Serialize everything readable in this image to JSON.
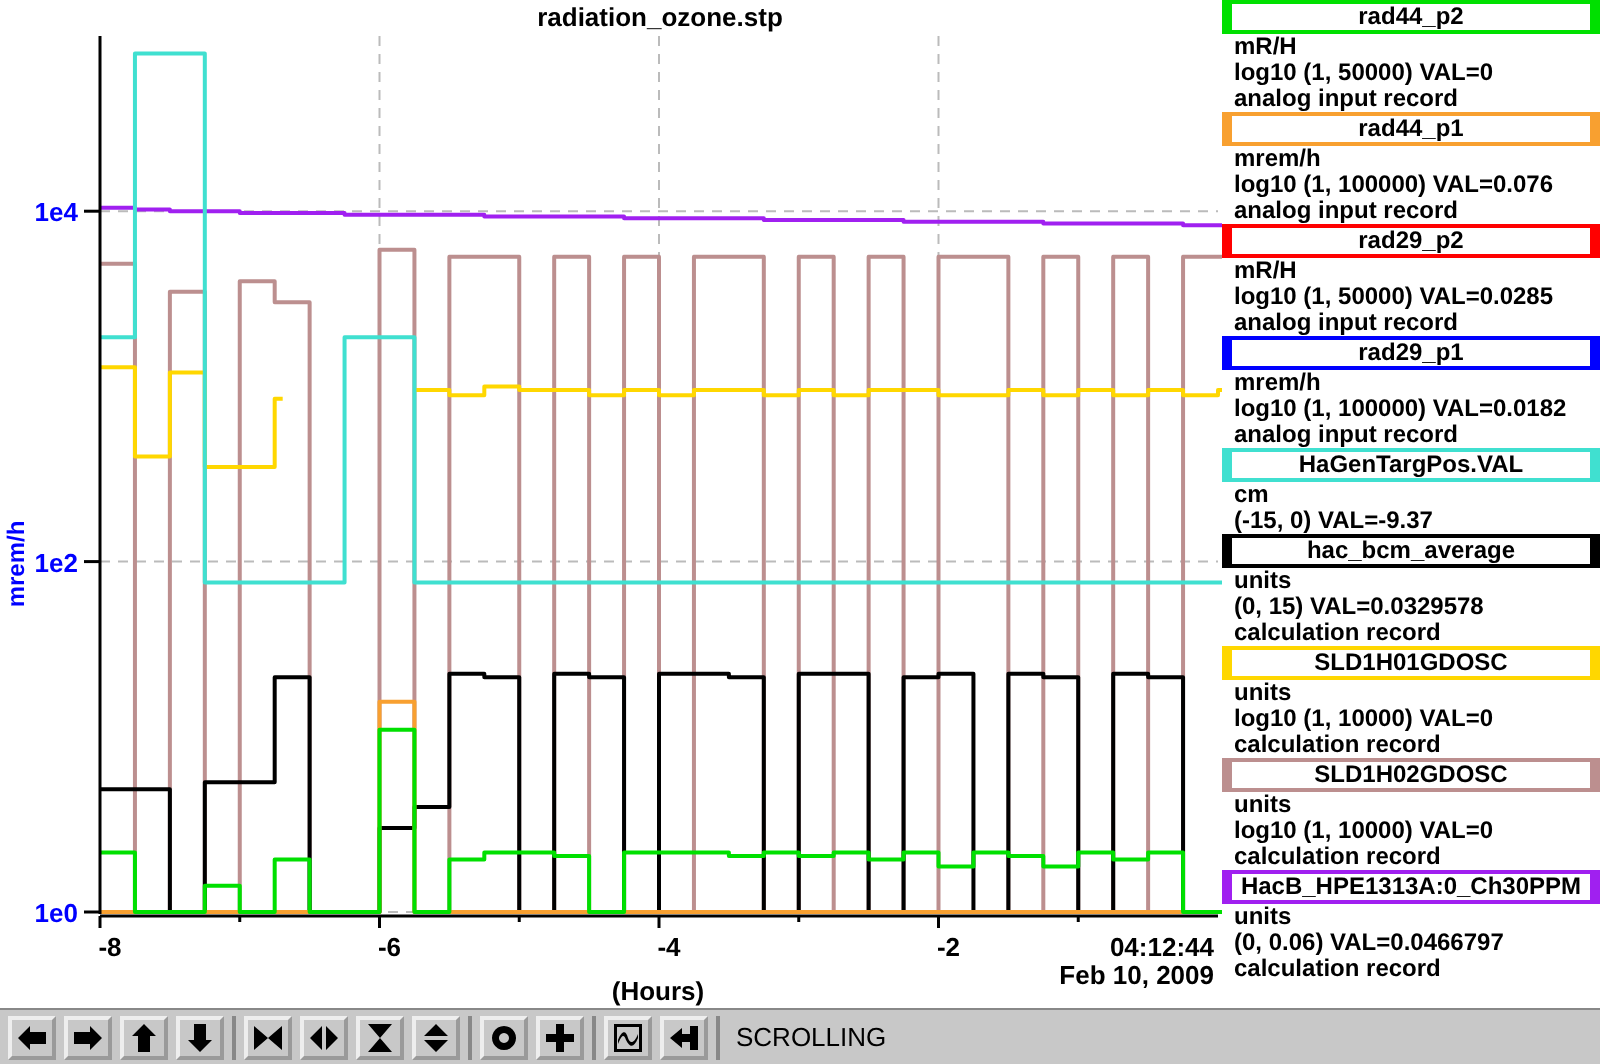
{
  "plot": {
    "title": "radiation_ozone.stp",
    "y_axis_label": "mrem/h",
    "y_tick_labels": [
      "1e4",
      "1e2",
      "1e0"
    ],
    "x_tick_labels": [
      "-8",
      "-6",
      "-4",
      "-2"
    ],
    "x_axis_label": "(Hours)",
    "time_label": "04:12:44",
    "date_label": "Feb 10, 2009"
  },
  "legend": [
    {
      "name": "rad44_p2",
      "color": "#00e000",
      "lines": [
        "mR/H",
        "log10 (1, 50000) VAL=0",
        "analog input record"
      ]
    },
    {
      "name": "rad44_p1",
      "color": "#f8a030",
      "lines": [
        "mrem/h",
        "log10 (1, 100000) VAL=0.076",
        "analog input record"
      ]
    },
    {
      "name": "rad29_p2",
      "color": "#ff0000",
      "lines": [
        "mR/H",
        "log10 (1, 50000) VAL=0.0285",
        "analog input record"
      ]
    },
    {
      "name": "rad29_p1",
      "color": "#0000ff",
      "lines": [
        "mrem/h",
        "log10 (1, 100000) VAL=0.0182",
        "analog input record"
      ]
    },
    {
      "name": "HaGenTargPos.VAL",
      "color": "#40e0d0",
      "lines": [
        "cm",
        "(-15, 0) VAL=-9.37"
      ]
    },
    {
      "name": "hac_bcm_average",
      "color": "#000000",
      "lines": [
        "units",
        "(0, 15) VAL=0.0329578",
        "calculation record"
      ]
    },
    {
      "name": "SLD1H01GDOSC",
      "color": "#ffd700",
      "lines": [
        "units",
        "log10 (1, 10000) VAL=0",
        "calculation record"
      ]
    },
    {
      "name": "SLD1H02GDOSC",
      "color": "#bc8f8f",
      "lines": [
        "units",
        "log10 (1, 10000) VAL=0",
        "calculation record"
      ]
    },
    {
      "name": "HacB_HPE1313A:0_Ch30PPM",
      "color": "#a020f0",
      "lines": [
        "units",
        "(0, 0.06) VAL=0.0466797",
        "calculation record"
      ]
    }
  ],
  "toolbar": {
    "groups": [
      [
        {
          "kind": "left"
        },
        {
          "kind": "right"
        },
        {
          "kind": "up"
        },
        {
          "kind": "down"
        }
      ],
      [
        {
          "kind": "zoom-in-x"
        },
        {
          "kind": "zoom-out-x"
        },
        {
          "kind": "zoom-in-y"
        },
        {
          "kind": "zoom-out-y"
        }
      ],
      [
        {
          "kind": "ring"
        },
        {
          "kind": "plus"
        }
      ],
      [
        {
          "kind": "graph"
        },
        {
          "kind": "exit"
        }
      ]
    ],
    "status": "SCROLLING"
  }
}
